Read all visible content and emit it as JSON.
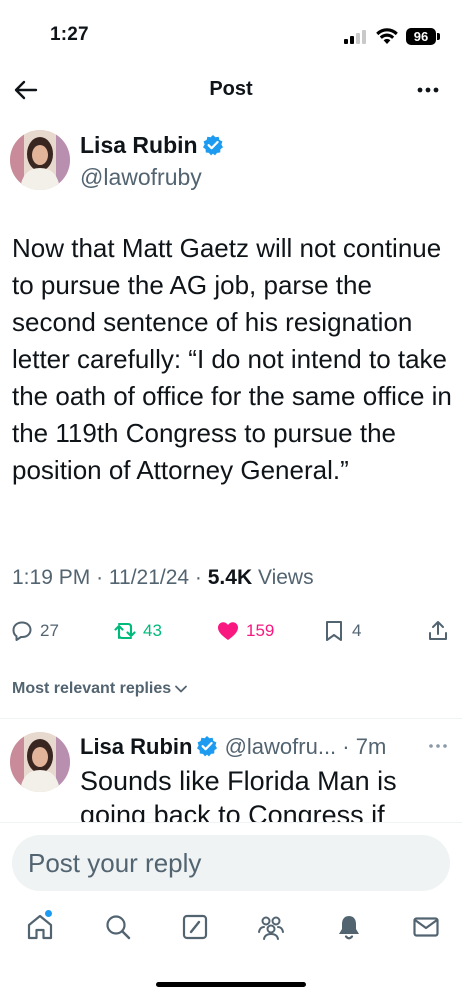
{
  "status_bar": {
    "time": "1:27",
    "battery": "96"
  },
  "header": {
    "title": "Post"
  },
  "author": {
    "name": "Lisa Rubin",
    "handle": "@lawofruby"
  },
  "tweet": {
    "text": "Now that Matt Gaetz will not continue to pursue the AG job, parse the second sentence of his resignation letter carefully: “I do not intend to take the oath of office for the same office in the 119th Congress to pursue the position of Attorney General.”",
    "time": "1:19 PM",
    "date": "11/21/24",
    "views_count": "5.4K",
    "views_label": "Views"
  },
  "actions": {
    "replies": "27",
    "reposts": "43",
    "likes": "159",
    "bookmarks": "4"
  },
  "replies_filter": {
    "label": "Most relevant replies"
  },
  "reply": {
    "name": "Lisa Rubin",
    "handle": "@lawofru...",
    "age": "7m",
    "text": "Sounds like Florida Man is going back to Congress if"
  },
  "compose": {
    "placeholder": "Post your reply"
  },
  "colors": {
    "accent": "#1d9bf0",
    "repost": "#00ba7c",
    "like": "#f91880",
    "secondary": "#536471"
  },
  "icons": [
    "back-arrow-icon",
    "more-icon",
    "verified-badge-icon",
    "reply-icon",
    "repost-icon",
    "heart-icon",
    "bookmark-icon",
    "share-icon",
    "chevron-down-icon",
    "home-icon",
    "search-icon",
    "grok-icon",
    "communities-icon",
    "bell-icon",
    "mail-icon"
  ]
}
